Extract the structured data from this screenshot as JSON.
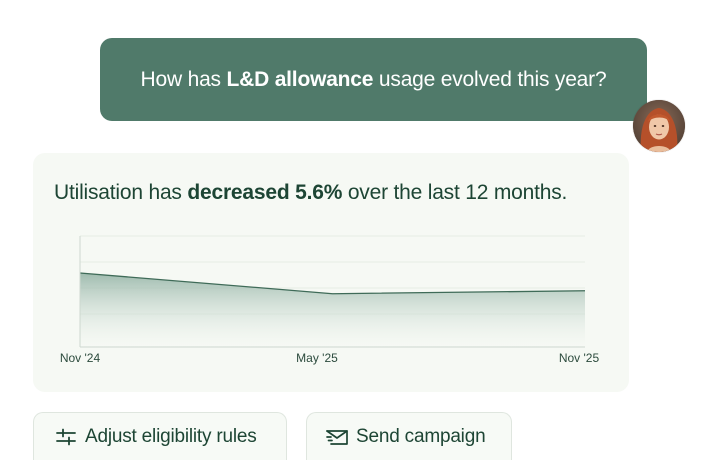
{
  "user_message": {
    "prefix": "How has ",
    "bold": "L&D allowance",
    "suffix": " usage evolved this year?"
  },
  "answer": {
    "prefix": "Utilisation has ",
    "bold": "decreased 5.6%",
    "suffix": " over the last 12 months."
  },
  "chart_data": {
    "type": "area",
    "x": [
      "Nov '24",
      "May '25",
      "Nov '25"
    ],
    "tick_labels": [
      "Nov '24",
      "May '25",
      "Nov '25"
    ],
    "values": [
      100,
      94.4,
      95.2
    ],
    "xlabel": "",
    "ylabel": "",
    "ylim": [
      80,
      110
    ],
    "grid": true,
    "legend": "none",
    "line_color": "#3f6b58",
    "fill_color": "#a9c2b6"
  },
  "actions": {
    "adjust_label": "Adjust eligibility rules",
    "send_label": "Send campaign"
  },
  "icons": {
    "adjust": "sliders-icon",
    "send": "mail-send-icon"
  },
  "colors": {
    "user_bubble": "#507a6a",
    "text_primary": "#1d4534",
    "card_bg": "#f6f9f4"
  }
}
